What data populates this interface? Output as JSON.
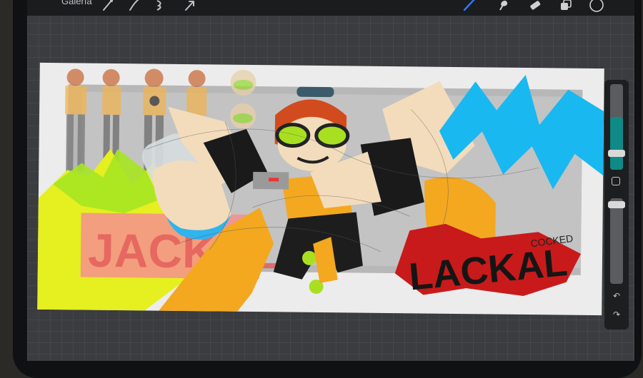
{
  "app": {
    "gallery_label": "Galería"
  },
  "toolbar": {
    "tools": [
      "brush-icon",
      "smudge-icon",
      "eraser-icon",
      "layers-icon",
      "color-icon"
    ],
    "adjust_tools": [
      "wand-icon",
      "selection-icon",
      "transform-icon"
    ],
    "active_tool": "brush-icon",
    "accent_color": "#2f7bf1",
    "current_color": "#1a1a1a"
  },
  "artwork": {
    "title_text": "LACKAL",
    "sub_text": "COCKED",
    "left_text": "JACKAL"
  },
  "sidebar": {
    "size_level": 0.62,
    "opacity_level": 0.0,
    "fill_color": "#0f8a86"
  }
}
